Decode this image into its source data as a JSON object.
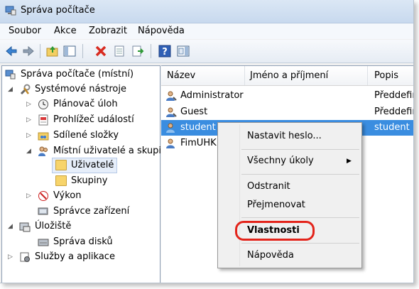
{
  "window": {
    "title": "Správa počítače"
  },
  "menu": [
    "Soubor",
    "Akce",
    "Zobrazit",
    "Nápověda"
  ],
  "toolbar": {
    "icons": [
      "back-arrow-icon",
      "forward-arrow-icon",
      "up-folder-icon",
      "show-hide-tree-icon",
      "delete-icon",
      "properties-icon",
      "export-icon",
      "help-icon",
      "show-hide-action-pane-icon"
    ]
  },
  "tree": {
    "root": "Správa počítače (místní)",
    "system_tools": "Systémové nástroje",
    "task_scheduler": "Plánovač úloh",
    "event_viewer": "Prohlížeč událostí",
    "shared_folders": "Sdílené složky",
    "local_users": "Místní uživatelé a skupiny",
    "users": "Uživatelé",
    "groups": "Skupiny",
    "performance": "Výkon",
    "device_manager": "Správce zařízení",
    "storage": "Úložiště",
    "disk_management": "Správa disků",
    "services": "Služby a aplikace"
  },
  "list": {
    "columns": [
      "Název",
      "Jméno a příjmení",
      "Popis"
    ],
    "rows": [
      {
        "name": "Administrator",
        "fullname": "",
        "description": "Předdefinovaný"
      },
      {
        "name": "Guest",
        "fullname": "",
        "description": "Předdefinovaný"
      },
      {
        "name": "student",
        "fullname": "",
        "description": "student"
      },
      {
        "name": "FimUHK",
        "fullname": "",
        "description": ""
      }
    ]
  },
  "context_menu": {
    "set_password": "Nastavit heslo...",
    "all_tasks": "Všechny úkoly",
    "delete": "Odstranit",
    "rename": "Přejmenovat",
    "properties": "Vlastnosti",
    "help": "Nápověda"
  },
  "colors": {
    "selection": "#3a8de0",
    "highlight_ring": "#e3241b"
  }
}
